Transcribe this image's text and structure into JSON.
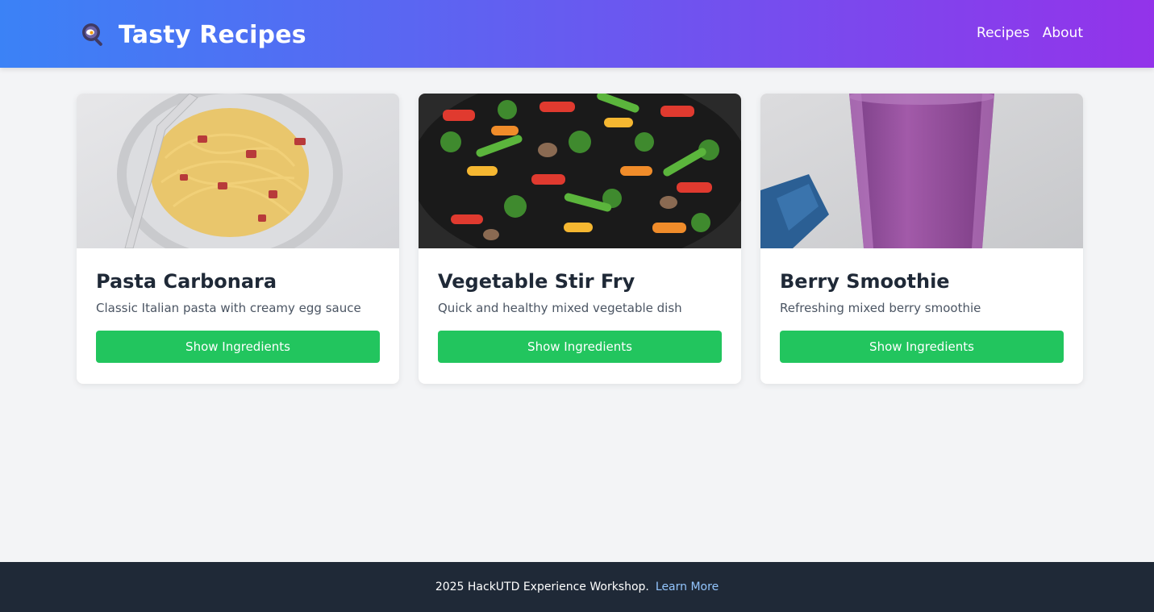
{
  "header": {
    "logo_icon": "magnifier-pan-icon",
    "title": "Tasty Recipes",
    "nav": [
      {
        "label": "Recipes"
      },
      {
        "label": "About"
      }
    ]
  },
  "cards": [
    {
      "title": "Pasta Carbonara",
      "description": "Classic Italian pasta with creamy egg sauce",
      "button": "Show Ingredients",
      "image": "pasta-carbonara-photo"
    },
    {
      "title": "Vegetable Stir Fry",
      "description": "Quick and healthy mixed vegetable dish",
      "button": "Show Ingredients",
      "image": "vegetable-stir-fry-photo"
    },
    {
      "title": "Berry Smoothie",
      "description": "Refreshing mixed berry smoothie",
      "button": "Show Ingredients",
      "image": "berry-smoothie-photo"
    }
  ],
  "footer": {
    "text": "2025 HackUTD Experience Workshop.",
    "link": "Learn More"
  },
  "colors": {
    "header_gradient_start": "#3b82f6",
    "header_gradient_end": "#9333ea",
    "button": "#22c55e",
    "footer_bg": "#1f2937",
    "footer_link": "#93c5fd",
    "page_bg": "#f3f4f6"
  }
}
